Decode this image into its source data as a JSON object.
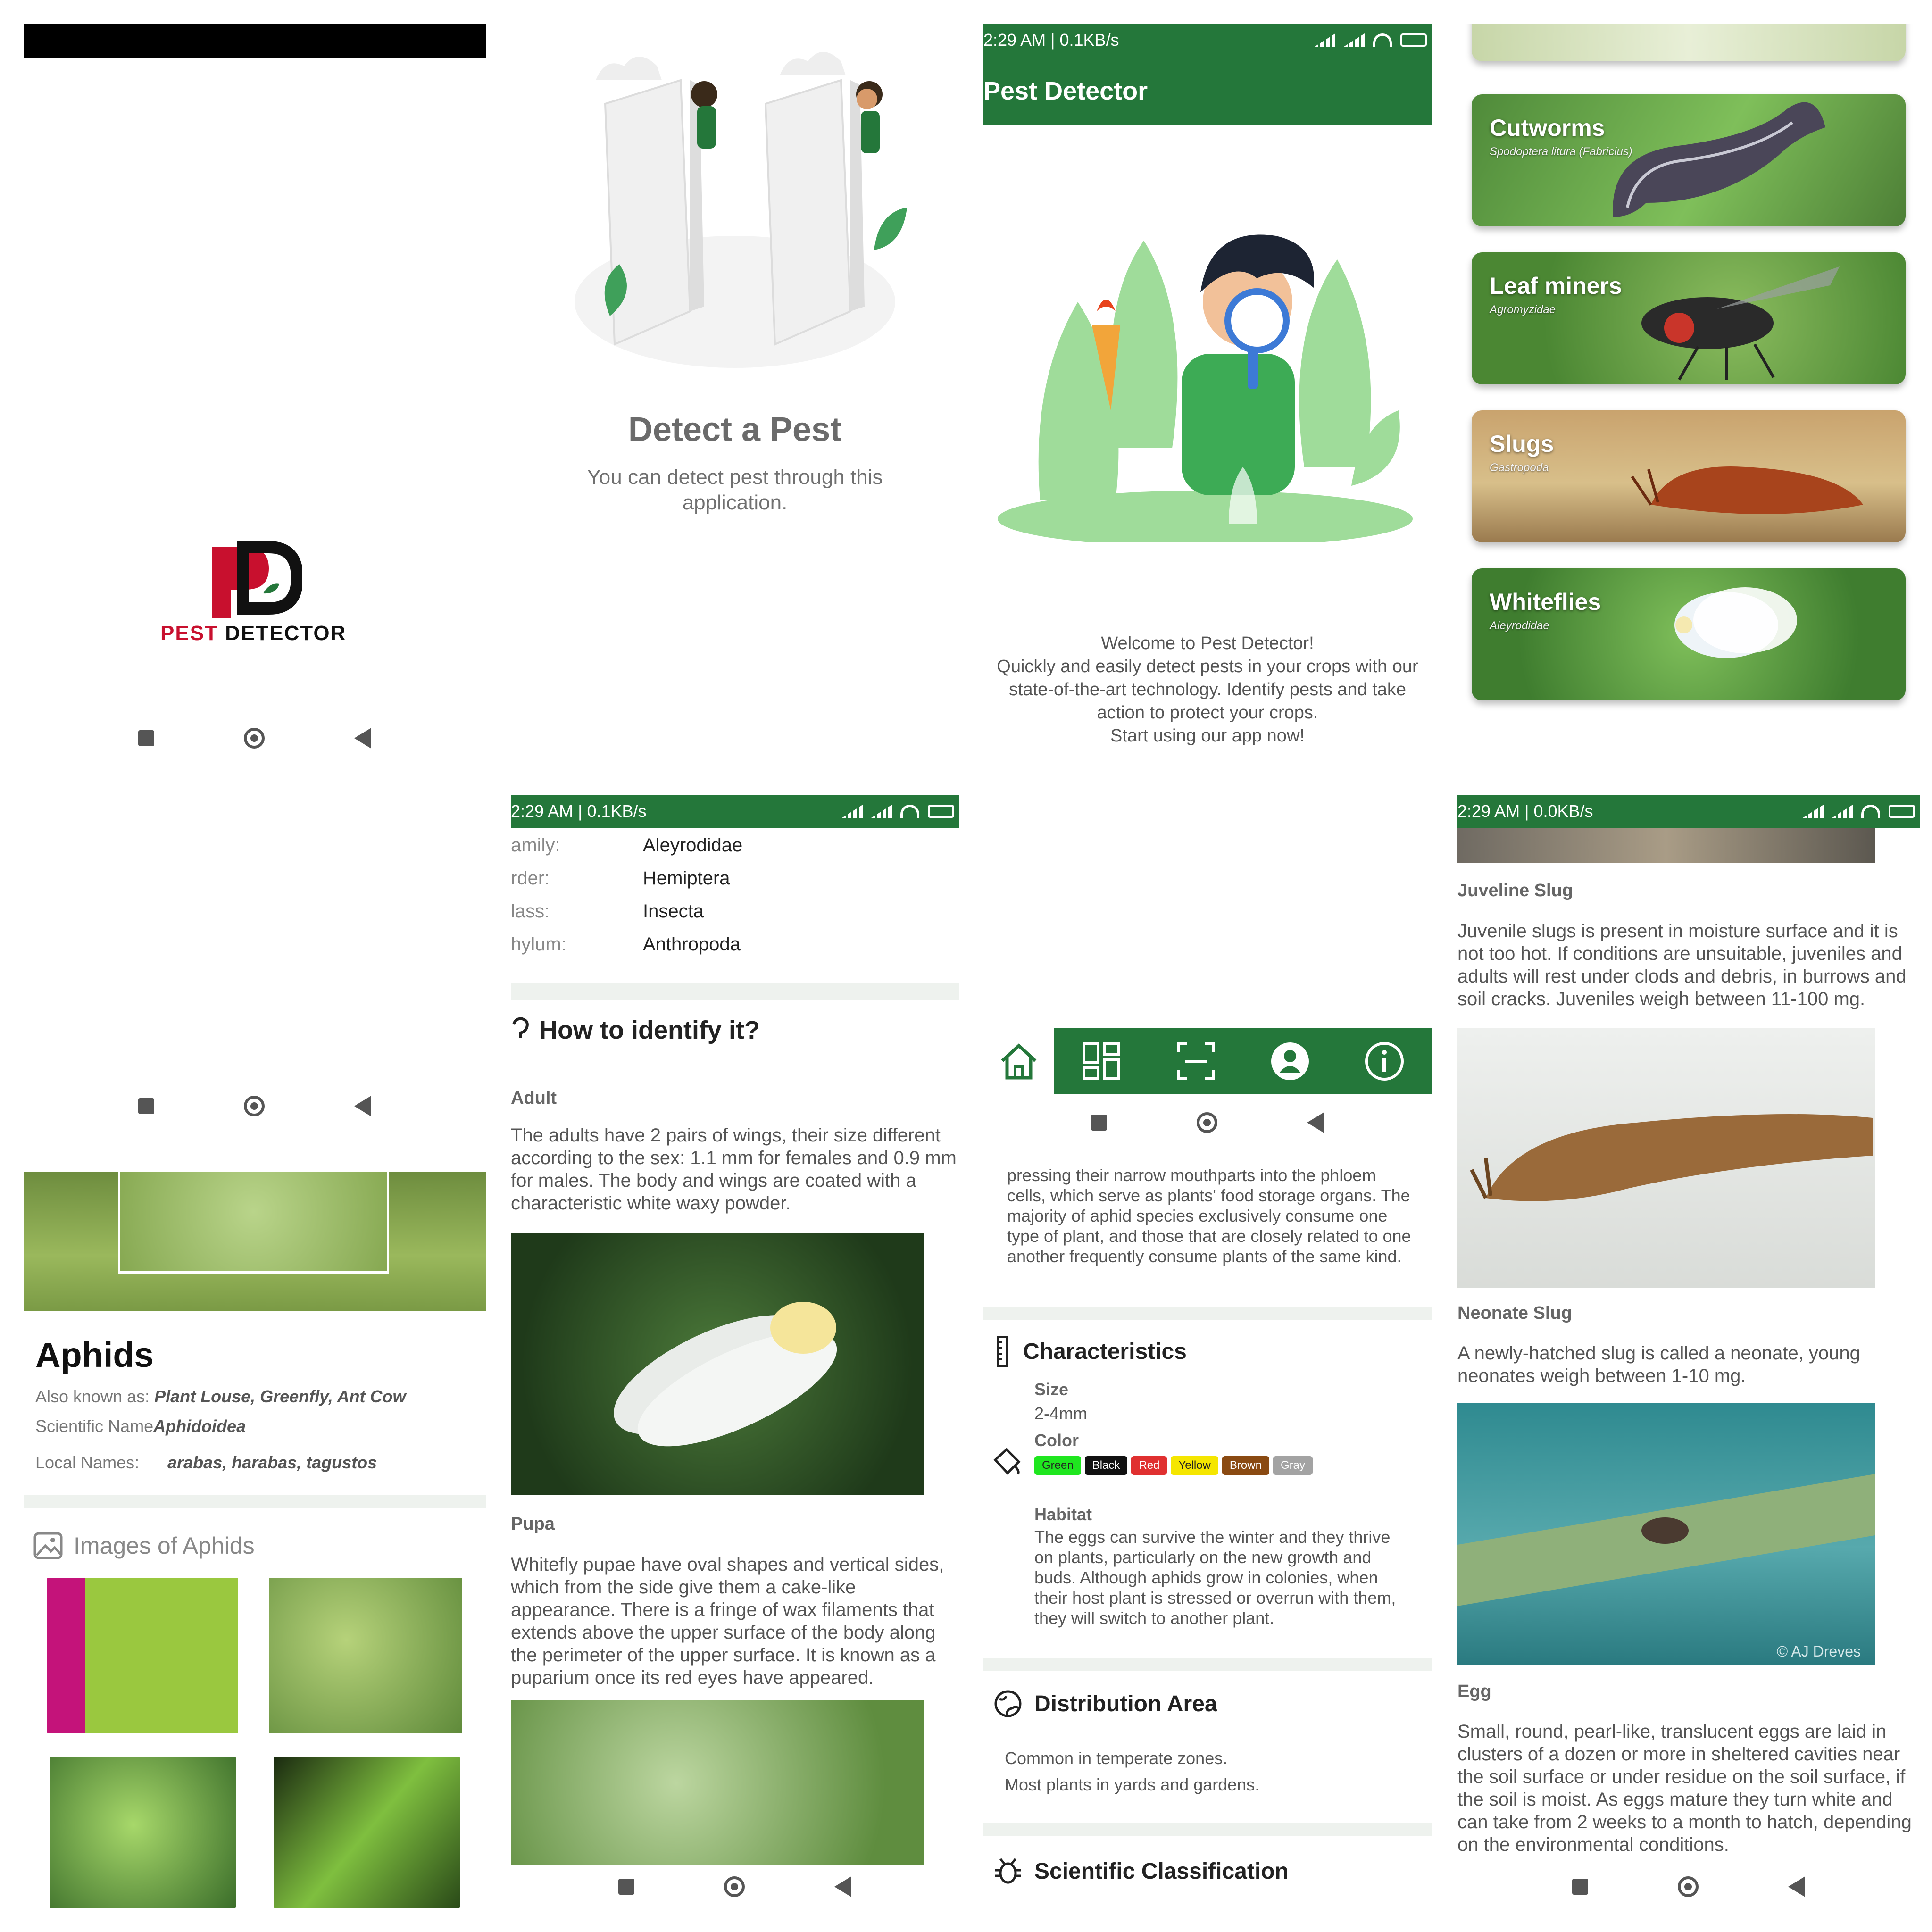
{
  "tile1": {
    "logo_letters": "PD",
    "logo_word1": "PEST",
    "logo_word2": "DETECTOR"
  },
  "tile2": {
    "title": "Detect a Pest",
    "subtitle": "You can detect pest through this application."
  },
  "tile3": {
    "status_time": "2:29 AM | 0.1KB/s",
    "app_title": "Pest Detector",
    "welcome_lines": [
      "Welcome to Pest Detector!",
      "Quickly and easily detect pests in your crops with our state-of-the-art technology. Identify pests and take action to protect your crops.",
      "Start using our app now!"
    ]
  },
  "tile4": {
    "cards": [
      {
        "name": "Cutworms",
        "scientific": "Spodoptera litura (Fabricius)"
      },
      {
        "name": "Leaf miners",
        "scientific": "Agromyzidae"
      },
      {
        "name": "Slugs",
        "scientific": "Gastropoda"
      },
      {
        "name": "Whiteflies",
        "scientific": "Aleyrodidae"
      }
    ]
  },
  "tile5": {
    "title": "Aphids",
    "aka_label": "Also known as:",
    "aka_value": "Plant Louse, Greenfly, Ant Cow",
    "sci_label": "Scientific Name",
    "sci_value": "Aphidoidea",
    "local_label": "Local Names:",
    "local_value": "arabas, harabas, tagustos",
    "images_label": "Images of Aphids"
  },
  "tile6": {
    "status_time": "2:29 AM | 0.1KB/s",
    "taxonomy": [
      {
        "k": "amily:",
        "v": "Aleyrodidae"
      },
      {
        "k": "rder:",
        "v": "Hemiptera"
      },
      {
        "k": "lass:",
        "v": "Insecta"
      },
      {
        "k": "hylum:",
        "v": "Anthropoda"
      }
    ],
    "identify_heading": "How to identify it?",
    "adult_label": "Adult",
    "adult_text": "The adults have 2 pairs of wings, their size different according to the sex: 1.1 mm for females and 0.9 mm for males. The body and wings are coated with a characteristic white waxy powder.",
    "pupa_label": "Pupa",
    "pupa_text": "Whitefly pupae have oval shapes and vertical sides, which from the side give them a cake-like appearance. There is a fringe of wax filaments that extends above the upper surface of the body along the perimeter of the upper surface. It is known as a puparium once its red eyes have appeared."
  },
  "tile7": {
    "intro_text": "pressing their narrow mouthparts into the phloem cells, which serve as plants' food storage organs. The majority of aphid species exclusively consume one type of plant, and those that are closely related to one another frequently consume plants of the same kind.",
    "char_heading": "Characteristics",
    "size_label": "Size",
    "size_value": "2-4mm",
    "color_label": "Color",
    "colors": [
      {
        "name": "Green",
        "bg": "#1fe61f"
      },
      {
        "name": "Black",
        "bg": "#111111"
      },
      {
        "name": "Red",
        "bg": "#e03030"
      },
      {
        "name": "Yellow",
        "bg": "#f5e600"
      },
      {
        "name": "Brown",
        "bg": "#8a4a12"
      },
      {
        "name": "Gray",
        "bg": "#a3a3a3"
      }
    ],
    "habitat_label": "Habitat",
    "habitat_text": "The eggs can survive the winter and they thrive on plants, particularly on the new growth and buds. Although aphids grow in colonies, when their host plant is stressed or overrun with them, they will switch to another plant.",
    "dist_heading": "Distribution Area",
    "dist_lines": [
      "Common in temperate zones.",
      "Most plants in yards and gardens."
    ],
    "sci_heading": "Scientific Classification"
  },
  "tile8": {
    "status_time": "2:29 AM | 0.0KB/s",
    "juv_label": "Juveline Slug",
    "juv_text": "Juvenile slugs is present in moisture surface and it is not too hot. If conditions are unsuitable, juveniles and adults will rest under clods and debris, in burrows and soil cracks. Juveniles weigh between 11-100 mg.",
    "neo_label": "Neonate Slug",
    "neo_text": "A newly-hatched slug is called a neonate, young neonates weigh between 1-10 mg.",
    "photo_credit": "© AJ Dreves",
    "egg_label": "Egg",
    "egg_text": "Small, round, pearl-like, translucent  eggs are laid in clusters of a dozen or more in sheltered cavities near the soil surface or under residue on the soil surface, if the soil is moist. As eggs mature they turn white and can take from 2 weeks to a month to hatch, depending on the environmental conditions."
  }
}
